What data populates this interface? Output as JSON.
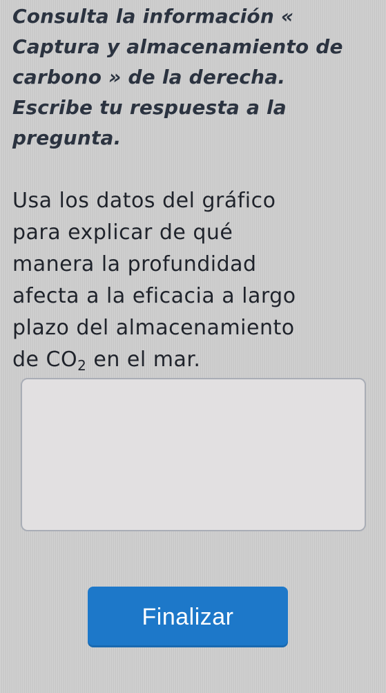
{
  "instructions": {
    "line1": "Consulta la información «",
    "line2": "Captura y almacenamiento de",
    "line3": "carbono » de la derecha.",
    "line4": "Escribe tu respuesta a la",
    "line5": "pregunta."
  },
  "question": {
    "line1": "Usa los datos del gráfico",
    "line2": "para explicar de qué",
    "line3": "manera la profundidad",
    "line4": "afecta a la eficacia a largo",
    "line5": "plazo del almacenamiento",
    "line6_before": "de ",
    "co2_base": "CO",
    "co2_sub": "2",
    "line6_after": " en el mar."
  },
  "answer": {
    "value": "",
    "placeholder": ""
  },
  "actions": {
    "finish_label": "Finalizar"
  },
  "colors": {
    "background": "#cfcfcf",
    "button": "#1d78c9",
    "button_text": "#ffffff",
    "text": "#262a33"
  }
}
